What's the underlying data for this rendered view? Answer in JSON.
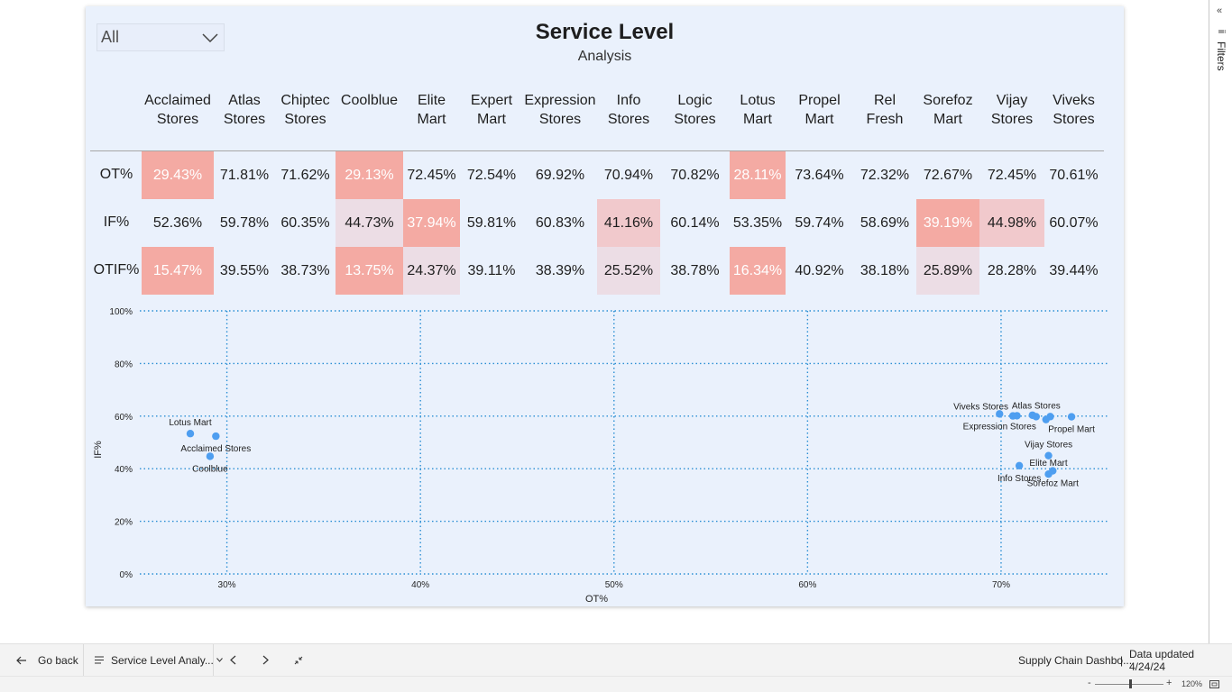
{
  "report": {
    "title": "Service Level",
    "subtitle": "Analysis",
    "slicer_value": "All"
  },
  "matrix": {
    "columns": [
      "Acclaimed\nStores",
      "Atlas\nStores",
      "Chiptec\nStores",
      "Coolblue",
      "Elite\nMart",
      "Expert\nMart",
      "Expression\nStores",
      "Info\nStores",
      "Logic\nStores",
      "Lotus\nMart",
      "Propel\nMart",
      "Rel\nFresh",
      "Sorefoz\nMart",
      "Vijay\nStores",
      "Viveks\nStores"
    ],
    "rows": [
      {
        "label": "OT%",
        "values": [
          "29.43%",
          "71.81%",
          "71.62%",
          "29.13%",
          "72.45%",
          "72.54%",
          "69.92%",
          "70.94%",
          "70.82%",
          "28.11%",
          "73.64%",
          "72.32%",
          "72.67%",
          "72.45%",
          "70.61%"
        ],
        "shade": [
          "strong",
          "",
          "",
          "strong",
          "",
          "",
          "",
          "",
          "",
          "strong",
          "",
          "",
          "",
          "",
          ""
        ]
      },
      {
        "label": "IF%",
        "values": [
          "52.36%",
          "59.78%",
          "60.35%",
          "44.73%",
          "37.94%",
          "59.81%",
          "60.83%",
          "41.16%",
          "60.14%",
          "53.35%",
          "59.74%",
          "58.69%",
          "39.19%",
          "44.98%",
          "60.07%"
        ],
        "shade": [
          "",
          "",
          "",
          "light",
          "strong",
          "",
          "",
          "mid",
          "",
          "",
          "",
          "",
          "strong",
          "mid",
          ""
        ]
      },
      {
        "label": "OTIF%",
        "values": [
          "15.47%",
          "39.55%",
          "38.73%",
          "13.75%",
          "24.37%",
          "39.11%",
          "38.39%",
          "25.52%",
          "38.78%",
          "16.34%",
          "40.92%",
          "38.18%",
          "25.89%",
          "28.28%",
          "39.44%"
        ],
        "shade": [
          "strong",
          "",
          "",
          "strong",
          "light",
          "",
          "",
          "light",
          "",
          "strong",
          "",
          "",
          "light",
          "",
          ""
        ]
      }
    ],
    "colors": {
      "strong": "#f4aaa3",
      "mid": "#f1c9cc",
      "light": "#ecdde5"
    }
  },
  "chart_data": {
    "type": "scatter",
    "xlabel": "OT%",
    "ylabel": "IF%",
    "xlim": [
      25.5,
      75.5
    ],
    "ylim": [
      0,
      100
    ],
    "xticks": [
      30,
      40,
      50,
      60,
      70
    ],
    "xtick_labels": [
      "30%",
      "40%",
      "50%",
      "60%",
      "70%"
    ],
    "yticks": [
      0,
      20,
      40,
      60,
      80,
      100
    ],
    "ytick_labels": [
      "0%",
      "20%",
      "40%",
      "60%",
      "80%",
      "100%"
    ],
    "grid": true,
    "point_color": "#4e9ef0",
    "points": [
      {
        "name": "Acclaimed Stores",
        "x": 29.43,
        "y": 52.36,
        "label": "Acclaimed Stores",
        "anchor": "below"
      },
      {
        "name": "Atlas Stores",
        "x": 71.81,
        "y": 59.78,
        "label": "Atlas Stores",
        "anchor": "above"
      },
      {
        "name": "Chiptec Stores",
        "x": 71.62,
        "y": 60.35,
        "label": "",
        "anchor": "none"
      },
      {
        "name": "Coolblue",
        "x": 29.13,
        "y": 44.73,
        "label": "Coolblue",
        "anchor": "below"
      },
      {
        "name": "Elite Mart",
        "x": 72.45,
        "y": 37.94,
        "label": "Elite Mart",
        "anchor": "above"
      },
      {
        "name": "Expert Mart",
        "x": 72.54,
        "y": 59.81,
        "label": "",
        "anchor": "none"
      },
      {
        "name": "Expression Stores",
        "x": 69.92,
        "y": 60.83,
        "label": "Expression Stores",
        "anchor": "below"
      },
      {
        "name": "Info Stores",
        "x": 70.94,
        "y": 41.16,
        "label": "Info Stores",
        "anchor": "below"
      },
      {
        "name": "Logic Stores",
        "x": 70.82,
        "y": 60.14,
        "label": "",
        "anchor": "none"
      },
      {
        "name": "Lotus Mart",
        "x": 28.11,
        "y": 53.35,
        "label": "Lotus Mart",
        "anchor": "above"
      },
      {
        "name": "Propel Mart",
        "x": 73.64,
        "y": 59.74,
        "label": "Propel Mart",
        "anchor": "below"
      },
      {
        "name": "Rel Fresh",
        "x": 72.32,
        "y": 58.69,
        "label": "",
        "anchor": "none"
      },
      {
        "name": "Sorefoz Mart",
        "x": 72.67,
        "y": 39.19,
        "label": "Sorefoz Mart",
        "anchor": "below"
      },
      {
        "name": "Vijay Stores",
        "x": 72.45,
        "y": 44.98,
        "label": "Vijay Stores",
        "anchor": "above"
      },
      {
        "name": "Viveks Stores",
        "x": 70.61,
        "y": 60.07,
        "label": "Viveks Stores",
        "anchor": "above-left"
      }
    ]
  },
  "filters_pane": {
    "collapse_icon": "double-chevron-left-icon",
    "filter_icon": "funnel-icon",
    "label": "Filters"
  },
  "bottom_bar": {
    "go_back": "Go back",
    "page_menu": "Service Level Analy...",
    "report_name": "Supply Chain Dashbo...",
    "divider": "|",
    "data_updated": "Data updated 4/24/24"
  },
  "status_bar": {
    "zoom_minus": "-",
    "zoom_plus": "+",
    "zoom_level": "120%"
  }
}
